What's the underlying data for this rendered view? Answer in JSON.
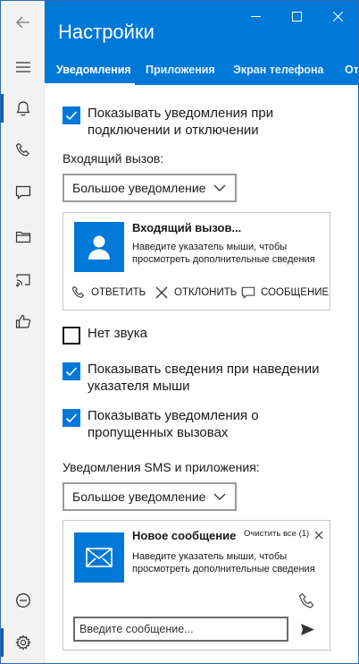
{
  "window": {
    "title": "Настройки"
  },
  "tabs": [
    {
      "label": "Уведомления",
      "active": true
    },
    {
      "label": "Приложения",
      "active": false
    },
    {
      "label": "Экран телефона",
      "active": false
    },
    {
      "label": "От",
      "active": false
    }
  ],
  "rail": {
    "items": [
      {
        "icon": "back-arrow-icon"
      },
      {
        "icon": "hamburger-menu-icon"
      },
      {
        "icon": "bell-icon"
      },
      {
        "icon": "phone-icon"
      },
      {
        "icon": "message-icon"
      },
      {
        "icon": "folder-icon"
      },
      {
        "icon": "cast-icon"
      },
      {
        "icon": "thumbs-up-icon"
      },
      {
        "icon": "do-not-disturb-icon"
      },
      {
        "icon": "gear-icon"
      }
    ]
  },
  "settings": {
    "show_connect_notifications": {
      "label": "Показывать уведомления при подключении и отключении",
      "checked": true
    },
    "incoming_call_label": "Входящий вызов:",
    "incoming_call_dropdown": "Большое уведомление",
    "mute": {
      "label": "Нет звука",
      "checked": false
    },
    "show_details_hover": {
      "label": "Показывать сведения при наведении указателя мыши",
      "checked": true
    },
    "show_missed_calls": {
      "label": "Показывать уведомления о пропущенных вызовах",
      "checked": true
    },
    "sms_label": "Уведомления SMS и приложения:",
    "sms_dropdown": "Большое уведомление"
  },
  "call_card": {
    "title": "Входящий вызов...",
    "text": "Наведите указатель мыши, чтобы просмотреть дополнительные сведения",
    "answer": "ОТВЕТИТЬ",
    "decline": "ОТКЛОНИТЬ",
    "message": "СООБЩЕНИЕ"
  },
  "sms_card": {
    "title": "Новое сообщение",
    "clear_all": "Очистить все (1)",
    "text": "Наведите указатель мыши, чтобы просмотреть дополнительные сведения",
    "input_placeholder": "Введите сообщение..."
  },
  "colors": {
    "accent": "#0078d7",
    "rail_bg": "#f2f2f2"
  }
}
